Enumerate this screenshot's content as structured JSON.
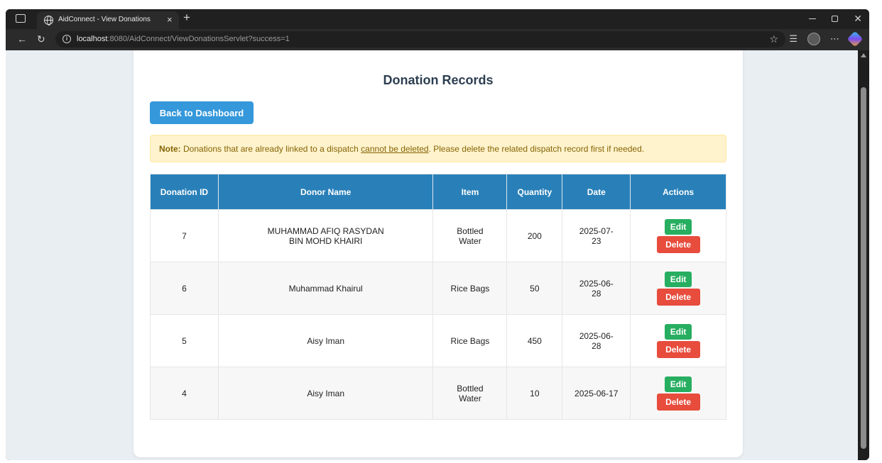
{
  "browser": {
    "tab_title": "AidConnect - View Donations",
    "tab_close": "×",
    "new_tab": "+",
    "url_host": "localhost",
    "url_rest": ":8080/AidConnect/ViewDonationsServlet?success=1",
    "icons": [
      "tab-actions-icon",
      "globe-icon",
      "back-icon",
      "reload-icon",
      "info-icon",
      "star-icon",
      "favorites-icon",
      "profile-icon",
      "more-icon",
      "copilot-icon"
    ]
  },
  "page": {
    "title": "Donation Records",
    "back_button": "Back to Dashboard",
    "note_label": "Note:",
    "note_text_1": " Donations that are already linked to a dispatch ",
    "note_emph": "cannot be deleted",
    "note_text_2": ". Please delete the related dispatch record first if needed."
  },
  "table": {
    "headers": [
      "Donation ID",
      "Donor Name",
      "Item",
      "Quantity",
      "Date",
      "Actions"
    ],
    "rows": [
      {
        "id": "7",
        "donor": "MUHAMMAD AFIQ RASYDAN BIN MOHD KHAIRI",
        "item": "Bottled Water",
        "quantity": "200",
        "date": "2025-07-23",
        "edit": "Edit",
        "delete": "Delete"
      },
      {
        "id": "6",
        "donor": "Muhammad Khairul",
        "item": "Rice Bags",
        "quantity": "50",
        "date": "2025-06-28",
        "edit": "Edit",
        "delete": "Delete"
      },
      {
        "id": "5",
        "donor": "Aisy Iman",
        "item": "Rice Bags",
        "quantity": "450",
        "date": "2025-06-28",
        "edit": "Edit",
        "delete": "Delete"
      },
      {
        "id": "4",
        "donor": "Aisy Iman",
        "item": "Bottled Water",
        "quantity": "10",
        "date": "2025-06-17",
        "edit": "Edit",
        "delete": "Delete"
      }
    ]
  },
  "colors": {
    "header": "#2980b9",
    "back_button": "#3498db",
    "edit": "#27ae60",
    "delete": "#e74c3c",
    "note_bg": "#fff3cd"
  }
}
